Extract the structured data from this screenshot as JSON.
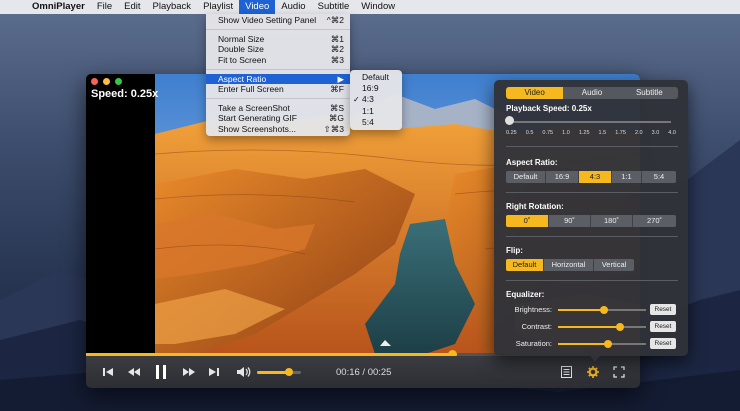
{
  "menubar": {
    "apple_icon": "apple-icon",
    "items": [
      "OmniPlayer",
      "File",
      "Edit",
      "Playback",
      "Playlist",
      "Video",
      "Audio",
      "Subtitle",
      "Window"
    ],
    "active": "Video"
  },
  "video_menu": {
    "show_setting_panel": {
      "label": "Show Video Setting Panel",
      "shortcut": "^⌘2"
    },
    "normal_size": {
      "label": "Normal Size",
      "shortcut": "⌘1"
    },
    "double_size": {
      "label": "Double Size",
      "shortcut": "⌘2"
    },
    "fit_to_screen": {
      "label": "Fit to Screen",
      "shortcut": "⌘3"
    },
    "aspect_ratio": {
      "label": "Aspect Ratio",
      "shortcut": "▶"
    },
    "enter_full_screen": {
      "label": "Enter Full Screen",
      "shortcut": "⌘F"
    },
    "take_screenshot": {
      "label": "Take a ScreenShot",
      "shortcut": "⌘S"
    },
    "start_gif": {
      "label": "Start Generating GIF",
      "shortcut": "⌘G"
    },
    "show_screenshots": {
      "label": "Show Screenshots...",
      "shortcut": "⇧⌘3"
    }
  },
  "aspect_submenu": {
    "items": [
      "Default",
      "16:9",
      "4:3",
      "1:1",
      "5:4"
    ],
    "checked": "4:3",
    "check_mark": "✓"
  },
  "player": {
    "speed_overlay": "Speed: 0.25x",
    "progress": 0.66,
    "time": "00:16 / 00:25",
    "volume": 0.72
  },
  "panel": {
    "tabs": [
      "Video",
      "Audio",
      "Subtitle"
    ],
    "active_tab": "Video",
    "playback_speed_label": "Playback Speed: 0.25x",
    "speed_ticks": [
      "0.25",
      "0.5",
      "0.75",
      "1.0",
      "1.25",
      "1.5",
      "1.75",
      "2.0",
      "3.0",
      "4.0"
    ],
    "aspect_ratio_label": "Aspect Ratio:",
    "aspect_options": [
      "Default",
      "16:9",
      "4:3",
      "1:1",
      "5:4"
    ],
    "aspect_active": "4:3",
    "rotation_label": "Right Rotation:",
    "rotation_options": [
      "0˚",
      "90˚",
      "180˚",
      "270˚"
    ],
    "rotation_active": "0˚",
    "flip_label": "Flip:",
    "flip_options": [
      "Default",
      "Horizontal",
      "Vertical"
    ],
    "flip_active": "Default",
    "equalizer_label": "Equalizer:",
    "eq": {
      "brightness": {
        "label": "Brightness:",
        "value": 0.52,
        "reset": "Reset"
      },
      "contrast": {
        "label": "Contrast:",
        "value": 0.7,
        "reset": "Reset"
      },
      "saturation": {
        "label": "Saturation:",
        "value": 0.57,
        "reset": "Reset"
      }
    }
  },
  "colors": {
    "accent": "#f5b81e",
    "menu_highlight": "#1e62d4"
  }
}
